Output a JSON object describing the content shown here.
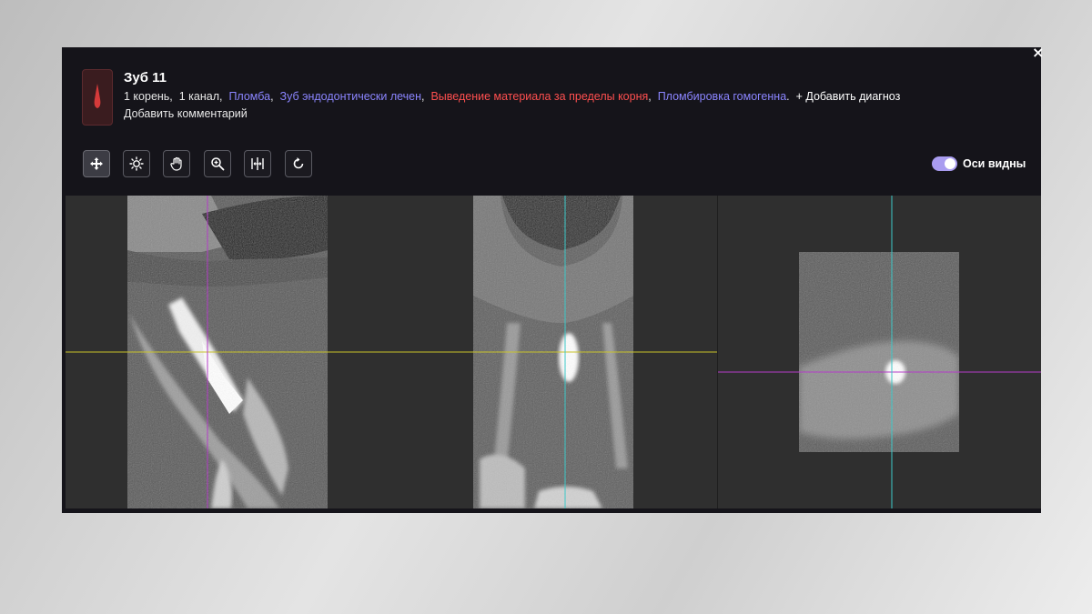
{
  "close_label": "×",
  "header": {
    "title": "Зуб 11",
    "roots": "1 корень,",
    "canals": "1 канал,",
    "diagnoses": [
      {
        "label": "Пломба",
        "color": "#8b85ff"
      },
      {
        "label": "Зуб эндодонтически лечен",
        "color": "#8b85ff"
      },
      {
        "label": "Выведение материала за пределы корня",
        "color": "#ff4f4f"
      },
      {
        "label": "Пломбировка гомогенна",
        "color": "#8b85ff"
      }
    ],
    "add_diagnosis": "+ Добавить диагноз",
    "add_comment": "Добавить комментарий"
  },
  "toolbar": {
    "tools": [
      {
        "name": "move-tool-button",
        "icon": "move-icon",
        "active": true
      },
      {
        "name": "brightness-tool-button",
        "icon": "sun-icon",
        "active": false
      },
      {
        "name": "pan-tool-button",
        "icon": "hand-icon",
        "active": false
      },
      {
        "name": "zoom-tool-button",
        "icon": "zoom-in-icon",
        "active": false
      },
      {
        "name": "measure-tool-button",
        "icon": "ruler-icon",
        "active": false
      },
      {
        "name": "reset-tool-button",
        "icon": "rotate-icon",
        "active": false
      }
    ],
    "axes_toggle": {
      "label": "Оси видны",
      "on": true
    }
  },
  "colors": {
    "accent_blue": "#8b85ff",
    "alert_red": "#ff4f4f",
    "toggle": "#a99cf0",
    "axis_yellow": "#c9c32a",
    "axis_magenta": "#b43cc8",
    "axis_cyan": "#3cc8c8"
  }
}
